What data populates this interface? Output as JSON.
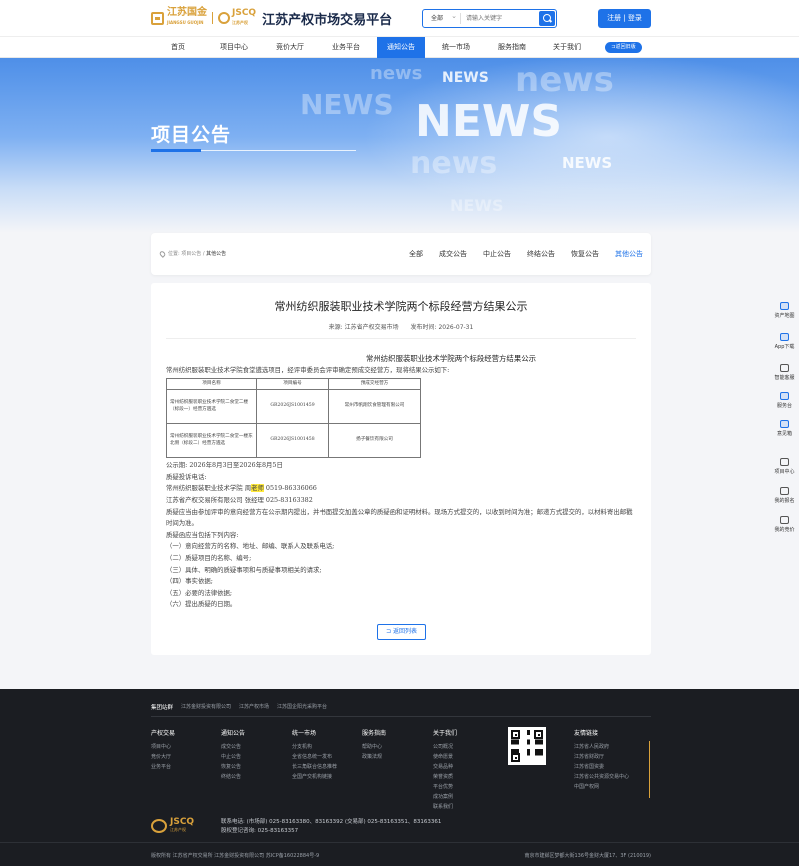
{
  "header": {
    "logo1_text": "江苏国金",
    "logo1_sub": "JIANGSU GUOJIN",
    "logo2_text": "JSCQ",
    "logo2_sub": "江苏产权",
    "site_title": "江苏产权市场交易平台",
    "search_select": "全部",
    "search_placeholder": "请输入关键字",
    "login_label": "注册 | 登录"
  },
  "nav": {
    "items": [
      "首页",
      "项目中心",
      "竞价大厅",
      "业务平台",
      "通知公告",
      "统一市场",
      "服务指南",
      "关于我们"
    ],
    "active": "通知公告",
    "badge": "⊐返回旧版"
  },
  "banner": {
    "title": "项目公告",
    "bg_words": [
      "news",
      "NEWS",
      "news",
      "NEWS",
      "NEWS",
      "news",
      "NEWS",
      "NEWS"
    ]
  },
  "breadcrumb": {
    "prefix": "位置:",
    "items": [
      "项目公告",
      "其他公告"
    ],
    "sep": "/"
  },
  "tabs": {
    "items": [
      "全部",
      "成交公告",
      "中止公告",
      "终结公告",
      "恢复公告",
      "其他公告"
    ],
    "active": "其他公告"
  },
  "article": {
    "title": "常州纺织服装职业技术学院两个标段经营方结果公示",
    "source": "来源: 江苏省产权交易市场",
    "date": "发布时间: 2026-07-31",
    "doc_heading": "常州纺织服装职业技术学院两个标段经营方结果公示",
    "intro": "常州纺织服装职业技术学院食堂遴选项目，经评审委员会评审确定预成交经营方，现将结果公示如下:",
    "table": {
      "headers": [
        "项目名称",
        "项目编号",
        "预成交经营方"
      ],
      "rows": [
        [
          "常州纺织服装职业技术学院二食堂二楼（标段一）经营方遴选",
          "GR2026JS1001459",
          "常州市帆翔饮食管理有限公司"
        ],
        [
          "常州纺织服装职业技术学院二食堂一楼东北侧（标段二）经营方遴选",
          "GR2026JS1001458",
          "扬子餐饮有限公司"
        ]
      ]
    },
    "period": "公示期: 2026年8月3日至2026年8月5日",
    "complaint_title": "质疑投诉电话:",
    "contact1_pre": "常州纺织服装职业技术学院  周",
    "contact1_hl": "老师",
    "contact1_post": " 0519-86336066",
    "contact2": "江苏省产权交易所有限公司  张经理  025-83163382",
    "notice1": "质疑应当由参加评审的意向经营方在公示期内提出，并书面提交加盖公章的质疑函和证明材料。现场方式提交的，以收到时间为准；邮递方式提交的，以材料寄出邮戳时间为准。",
    "notice_list_title": "质疑函应当包括下列内容:",
    "notice_list": [
      "（一）意向经营方的名称、地址、邮编、联系人及联系电话;",
      "（二）质疑项目的名称、编号;",
      "（三）具体、明确的质疑事项和与质疑事项相关的请求;",
      "（四）事实依据;",
      "（五）必要的法律依据;",
      "（六）提出质疑的日期。"
    ],
    "return_label": "⊐ 返回列表"
  },
  "side": {
    "items": [
      "资产地图",
      "App下载",
      "智能客服",
      "服务台",
      "意见箱",
      "项目中心",
      "我的报名",
      "我的竞价"
    ]
  },
  "footer": {
    "group_label": "集团站群",
    "group_links": [
      "江苏金财投资有限公司",
      "江苏产权市场",
      "江苏国企阳光采购平台"
    ],
    "columns": [
      {
        "title": "产权交易",
        "links": [
          "项目中心",
          "竞价大厅",
          "业务平台"
        ]
      },
      {
        "title": "通知公告",
        "links": [
          "成交公告",
          "中止公告",
          "恢复公告",
          "终结公告"
        ]
      },
      {
        "title": "统一市场",
        "links": [
          "分支机构",
          "全省信息统一发布",
          "长三角联合信息推荐",
          "全国产交机构链接"
        ]
      },
      {
        "title": "服务指南",
        "links": [
          "帮助中心",
          "政策法规"
        ]
      },
      {
        "title": "关于我们",
        "links": [
          "公司概况",
          "使命愿景",
          "交易品种",
          "荣誉资质",
          "平台优势",
          "成功案例",
          "联系我们"
        ]
      },
      {
        "title": "友情链接",
        "links": [
          "江苏省人民政府",
          "江苏省财政厅",
          "江苏省国资委",
          "江苏省公共资源交易中心",
          "中国产权网"
        ]
      }
    ],
    "logo_text": "JSCQ",
    "logo_sub": "江苏产权",
    "contact_line1": "联系电话:  (市场部) 025-83163380、83163392  (交易部) 025-83163351、83163361",
    "contact_line2": "股权登记咨询: 025-83163357",
    "copyright": "版权所有  江苏省产权交易所   江苏金财投资有限公司 苏ICP备16022884号-9",
    "address": "南京市建邺区梦都大街136号金财大厦17、3F (210019)"
  }
}
